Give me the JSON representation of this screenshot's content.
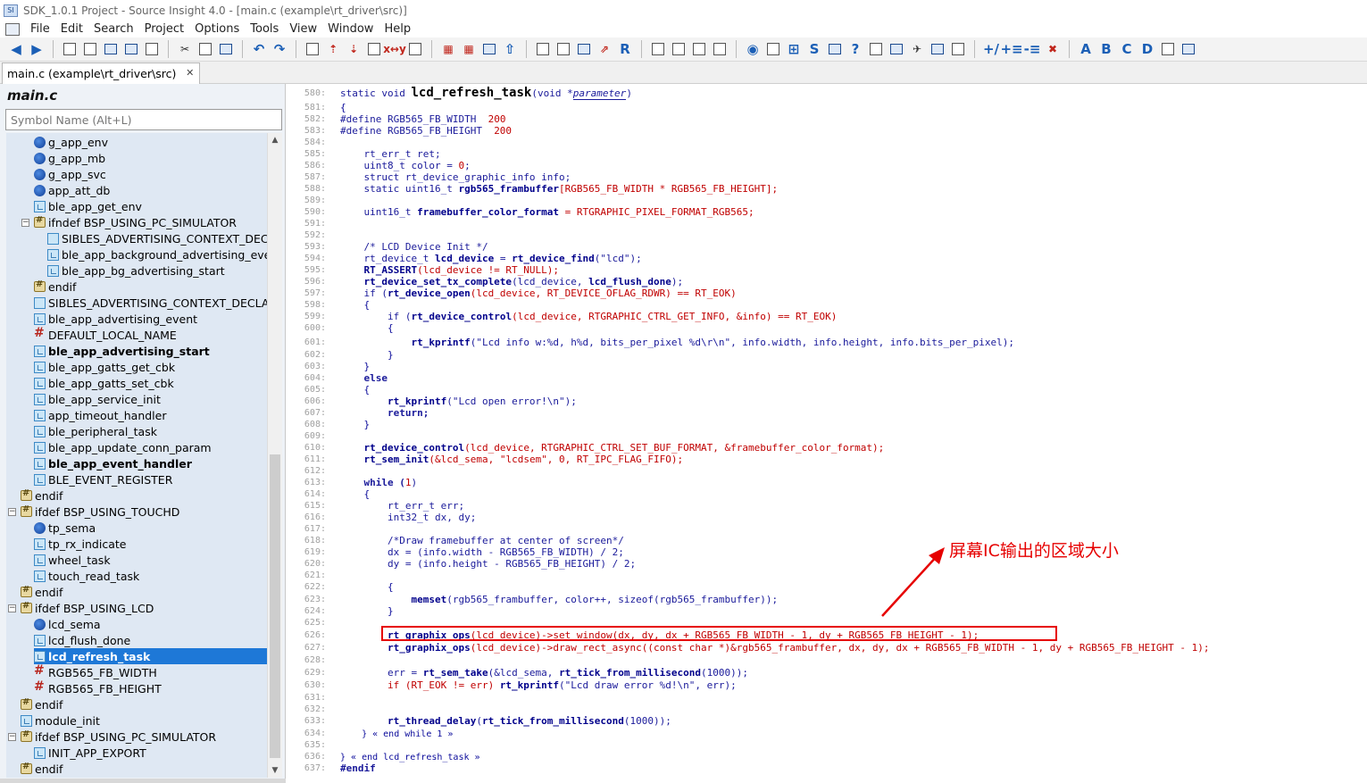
{
  "window": {
    "title": "SDK_1.0.1 Project - Source Insight 4.0 - [main.c (example\\rt_driver\\src)]"
  },
  "menu": [
    "File",
    "Edit",
    "Search",
    "Project",
    "Options",
    "Tools",
    "View",
    "Window",
    "Help"
  ],
  "tab": {
    "label": "main.c (example\\rt_driver\\src)",
    "close": "✕"
  },
  "symbol_panel": {
    "title": "main.c",
    "search_placeholder": "Symbol Name (Alt+L)",
    "items": [
      {
        "label": "g_app_env",
        "icon": "var-icon",
        "indent": 1
      },
      {
        "label": "g_app_mb",
        "icon": "var-icon",
        "indent": 1
      },
      {
        "label": "g_app_svc",
        "icon": "var-icon",
        "indent": 1
      },
      {
        "label": "app_att_db",
        "icon": "var-icon",
        "indent": 1
      },
      {
        "label": "ble_app_get_env",
        "icon": "function-icon",
        "indent": 1
      },
      {
        "label": "ifndef BSP_USING_PC_SIMULATOR",
        "icon": "preprocessor-icon",
        "indent": 1,
        "expander": "−"
      },
      {
        "label": "SIBLES_ADVERTISING_CONTEXT_DECLA",
        "icon": "struct-icon",
        "indent": 2
      },
      {
        "label": "ble_app_background_advertising_event",
        "icon": "function-icon",
        "indent": 2
      },
      {
        "label": "ble_app_bg_advertising_start",
        "icon": "function-icon",
        "indent": 2
      },
      {
        "label": "endif",
        "icon": "preprocessor-icon",
        "indent": 1
      },
      {
        "label": "SIBLES_ADVERTISING_CONTEXT_DECLAR",
        "icon": "struct-icon",
        "indent": 1
      },
      {
        "label": "ble_app_advertising_event",
        "icon": "function-icon",
        "indent": 1
      },
      {
        "label": "DEFAULT_LOCAL_NAME",
        "icon": "define-icon",
        "indent": 1
      },
      {
        "label": "ble_app_advertising_start",
        "icon": "function-icon",
        "indent": 1,
        "bold": true
      },
      {
        "label": "ble_app_gatts_get_cbk",
        "icon": "function-icon",
        "indent": 1
      },
      {
        "label": "ble_app_gatts_set_cbk",
        "icon": "function-icon",
        "indent": 1
      },
      {
        "label": "ble_app_service_init",
        "icon": "function-icon",
        "indent": 1
      },
      {
        "label": "app_timeout_handler",
        "icon": "function-icon",
        "indent": 1
      },
      {
        "label": "ble_peripheral_task",
        "icon": "function-icon",
        "indent": 1
      },
      {
        "label": "ble_app_update_conn_param",
        "icon": "function-icon",
        "indent": 1
      },
      {
        "label": "ble_app_event_handler",
        "icon": "function-icon",
        "indent": 1,
        "bold": true
      },
      {
        "label": "BLE_EVENT_REGISTER",
        "icon": "function-icon",
        "indent": 1
      },
      {
        "label": "endif",
        "icon": "preprocessor-icon",
        "indent": 0
      },
      {
        "label": "ifdef BSP_USING_TOUCHD",
        "icon": "preprocessor-icon",
        "indent": 0,
        "expander": "−"
      },
      {
        "label": "tp_sema",
        "icon": "var-icon",
        "indent": 1
      },
      {
        "label": "tp_rx_indicate",
        "icon": "function-icon",
        "indent": 1
      },
      {
        "label": "wheel_task",
        "icon": "function-icon",
        "indent": 1
      },
      {
        "label": "touch_read_task",
        "icon": "function-icon",
        "indent": 1
      },
      {
        "label": "endif",
        "icon": "preprocessor-icon",
        "indent": 0
      },
      {
        "label": "ifdef BSP_USING_LCD",
        "icon": "preprocessor-icon",
        "indent": 0,
        "expander": "−"
      },
      {
        "label": "lcd_sema",
        "icon": "var-icon",
        "indent": 1
      },
      {
        "label": "lcd_flush_done",
        "icon": "function-icon",
        "indent": 1
      },
      {
        "label": "lcd_refresh_task",
        "icon": "function-icon",
        "indent": 1,
        "bold": true,
        "selected": true
      },
      {
        "label": "RGB565_FB_WIDTH",
        "icon": "define-icon",
        "indent": 1
      },
      {
        "label": "RGB565_FB_HEIGHT",
        "icon": "define-icon",
        "indent": 1
      },
      {
        "label": "endif",
        "icon": "preprocessor-icon",
        "indent": 0
      },
      {
        "label": "module_init",
        "icon": "function-icon",
        "indent": 0
      },
      {
        "label": "ifdef BSP_USING_PC_SIMULATOR",
        "icon": "preprocessor-icon",
        "indent": 0,
        "expander": "−"
      },
      {
        "label": "INIT_APP_EXPORT",
        "icon": "function-icon",
        "indent": 1
      },
      {
        "label": "endif",
        "icon": "preprocessor-icon",
        "indent": 0
      }
    ]
  },
  "editor": {
    "line_numbers": [
      "580:",
      "581:",
      "582:",
      "583:",
      "584:",
      "585:",
      "586:",
      "587:",
      "588:",
      "589:",
      "590:",
      "591:",
      "592:",
      "593:",
      "594:",
      "595:",
      "596:",
      "597:",
      "598:",
      "599:",
      "600:",
      "601:",
      "602:",
      "603:",
      "604:",
      "605:",
      "606:",
      "607:",
      "608:",
      "609:",
      "610:",
      "611:",
      "612:",
      "613:",
      "614:",
      "615:",
      "616:",
      "617:",
      "618:",
      "619:",
      "620:",
      "621:",
      "622:",
      "623:",
      "624:",
      "625:",
      "626:",
      "627:",
      "628:",
      "629:",
      "630:",
      "631:",
      "632:",
      "633:",
      "634:",
      "635:",
      "636:",
      "637:"
    ],
    "code": {
      "l580_a": "static void ",
      "l580_fn": "lcd_refresh_task",
      "l580_b": "(void *",
      "l580_param": "parameter",
      "l580_c": ")",
      "l581": "{",
      "l582_a": "#define RGB565_FB_WIDTH  ",
      "l582_n": "200",
      "l583_a": "#define RGB565_FB_HEIGHT  ",
      "l583_n": "200",
      "l585": "    rt_err_t ret;",
      "l586_a": "    uint8_t color = ",
      "l586_n": "0",
      "l586_b": ";",
      "l587": "    struct rt_device_graphic_info info;",
      "l588_a": "    static uint16_t ",
      "l588_b": "rgb565_frambuffer",
      "l588_c": "[RGB565_FB_WIDTH * RGB565_FB_HEIGHT];",
      "l590_a": "    uint16_t ",
      "l590_b": "framebuffer_color_format",
      "l590_c": " = RTGRAPHIC_PIXEL_FORMAT_RGB565;",
      "l593": "    /* LCD Device Init */",
      "l594_a": "    rt_device_t ",
      "l594_b": "lcd_device",
      "l594_c": " = ",
      "l594_d": "rt_device_find",
      "l594_e": "(\"lcd\");",
      "l595_a": "    RT_ASSERT",
      "l595_b": "(lcd_device != RT_NULL);",
      "l596_a": "    rt_device_set_tx_complete",
      "l596_b": "(lcd_device, ",
      "l596_c": "lcd_flush_done",
      "l596_d": ");",
      "l597_a": "    if (",
      "l597_b": "rt_device_open",
      "l597_c": "(lcd_device, RT_DEVICE_OFLAG_RDWR) == RT_EOK)",
      "l598": "    {",
      "l599_a": "        if (",
      "l599_b": "rt_device_control",
      "l599_c": "(lcd_device, RTGRAPHIC_CTRL_GET_INFO, &info) == RT_EOK)",
      "l600": "        {",
      "l601_a": "            ",
      "l601_b": "rt_kprintf",
      "l601_c": "(\"Lcd info w:%d, h%d, bits_per_pixel %d\\r\\n\", info.width, info.height, info.bits_per_pixel);",
      "l602": "        }",
      "l603": "    }",
      "l604": "    else",
      "l605": "    {",
      "l606_a": "        ",
      "l606_b": "rt_kprintf",
      "l606_c": "(\"Lcd open error!\\n\");",
      "l607": "        return;",
      "l608": "    }",
      "l610_a": "    ",
      "l610_b": "rt_device_control",
      "l610_c": "(lcd_device, RTGRAPHIC_CTRL_SET_BUF_FORMAT, &framebuffer_color_format);",
      "l611_a": "    ",
      "l611_b": "rt_sem_init",
      "l611_c": "(&lcd_sema, \"lcdsem\", 0, RT_IPC_FLAG_FIFO);",
      "l613_a": "    while (",
      "l613_n": "1",
      "l613_b": ")",
      "l614": "    {",
      "l615": "        rt_err_t err;",
      "l616": "        int32_t dx, dy;",
      "l618": "        /*Draw framebuffer at center of screen*/",
      "l619": "        dx = (info.width - RGB565_FB_WIDTH) / 2;",
      "l620": "        dy = (info.height - RGB565_FB_HEIGHT) / 2;",
      "l622": "        {",
      "l623_a": "            ",
      "l623_b": "memset",
      "l623_c": "(rgb565_frambuffer, color++, sizeof(rgb565_frambuffer));",
      "l624": "        }",
      "l626_a": "        ",
      "l626_b": "rt_graphix_ops",
      "l626_c": "(lcd_device)->set_window(dx, dy, dx + RGB565_FB_WIDTH - 1, dy + RGB565_FB_HEIGHT - 1);",
      "l627_a": "        ",
      "l627_b": "rt_graphix_ops",
      "l627_c": "(lcd_device)->draw_rect_async((const char *)&rgb565_frambuffer, dx, dy, dx + RGB565_FB_WIDTH - 1, dy + RGB565_FB_HEIGHT - 1);",
      "l629_a": "        err = ",
      "l629_b": "rt_sem_take",
      "l629_c": "(&lcd_sema, ",
      "l629_d": "rt_tick_from_millisecond",
      "l629_e": "(1000));",
      "l630_a": "        if (RT_EOK != err) ",
      "l630_b": "rt_kprintf",
      "l630_c": "(\"Lcd draw error %d!\\n\", err);",
      "l633_a": "        ",
      "l633_b": "rt_thread_delay",
      "l633_c": "(",
      "l633_d": "rt_tick_from_millisecond",
      "l633_e": "(1000));",
      "l634": "    } « end while 1 »",
      "l636": "} « end lcd_refresh_task »",
      "l637": "#endif"
    }
  },
  "annotation": {
    "text": "屏幕IC输出的区域大小",
    "color": "#e60000"
  }
}
